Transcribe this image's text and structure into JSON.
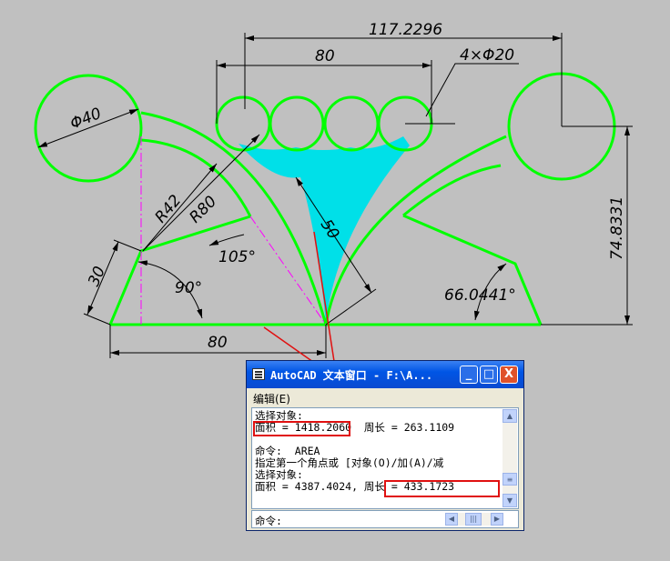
{
  "drawing": {
    "dimensions": {
      "overall_width": "117.2296",
      "circles_width": "80",
      "circles_note": "4×Φ20",
      "diameter_left": "Φ40",
      "radius_small": "R42",
      "radius_large": "R80",
      "chord_50": "50",
      "side_30": "30",
      "angle_105": "105°",
      "angle_90": "90°",
      "angle_66": "66.0441°",
      "base_80": "80",
      "height": "74.8331"
    },
    "colors": {
      "background": "#c0c0c0",
      "outline": "#00ff00",
      "fill_region": "#00e0e8",
      "centerline": "#ff00ff",
      "annotation_arrow": "#e01010"
    }
  },
  "text_window": {
    "title": "AutoCAD 文本窗口 - F:\\A...",
    "menu_edit": "编辑(E)",
    "lines": [
      "选择对象:",
      "面积 = 1418.2060  周长 = 263.1109",
      "",
      "命令:  AREA",
      "指定第一个角点或 [对象(O)/加(A)/减",
      "选择对象:",
      "面积 = 4387.4024, 周长 = 433.1723"
    ],
    "command_prompt": "命令:",
    "buttons": {
      "minimize": "_",
      "maximize": "□",
      "close": "X"
    }
  }
}
